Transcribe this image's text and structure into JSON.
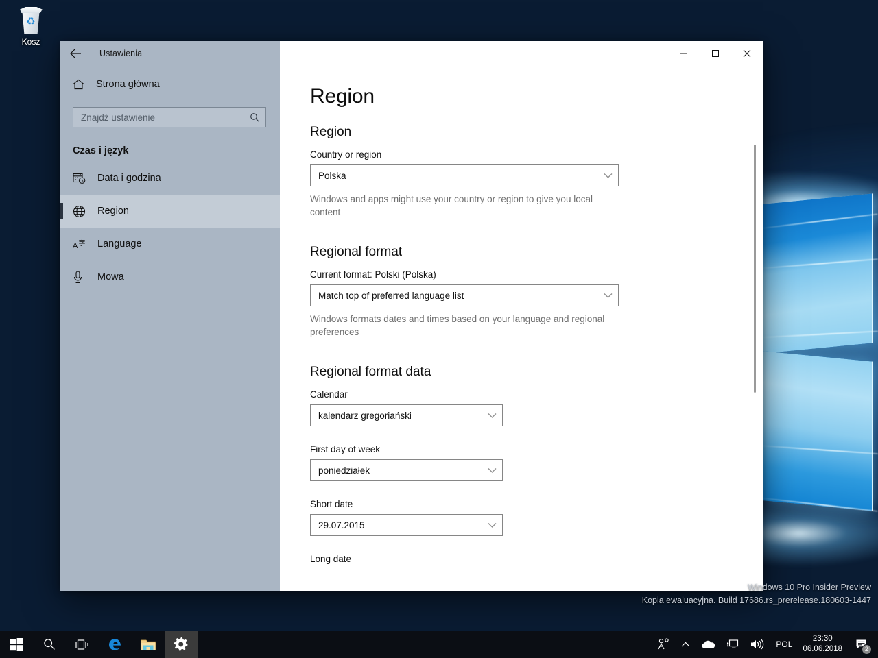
{
  "desktop": {
    "recycle_bin_label": "Kosz",
    "recycle_bin_icon": "recycle-bin-icon"
  },
  "window": {
    "title": "Ustawienia",
    "back_icon": "back-arrow-icon",
    "controls": {
      "minimize": "minimize-icon",
      "maximize": "maximize-icon",
      "close": "close-icon"
    }
  },
  "sidebar": {
    "home_label": "Strona główna",
    "home_icon": "home-icon",
    "search": {
      "placeholder": "Znajdź ustawienie",
      "value": "",
      "icon": "search-icon"
    },
    "section_title": "Czas i język",
    "items": [
      {
        "label": "Data i godzina",
        "icon": "calendar-clock-icon",
        "active": false
      },
      {
        "label": "Region",
        "icon": "globe-icon",
        "active": true
      },
      {
        "label": "Language",
        "icon": "language-icon",
        "active": false
      },
      {
        "label": "Mowa",
        "icon": "microphone-icon",
        "active": false
      }
    ]
  },
  "content": {
    "page_title": "Region",
    "sections": {
      "region": {
        "heading": "Region",
        "country_label": "Country or region",
        "country_value": "Polska",
        "country_helper": "Windows and apps might use your country or region to give you local content"
      },
      "regional_format": {
        "heading": "Regional format",
        "current_format_label": "Current format: Polski (Polska)",
        "format_value": "Match top of preferred language list",
        "format_helper": "Windows formats dates and times based on your language and regional preferences"
      },
      "regional_format_data": {
        "heading": "Regional format data",
        "fields": [
          {
            "label": "Calendar",
            "value": "kalendarz gregoriański"
          },
          {
            "label": "First day of week",
            "value": "poniedziałek"
          },
          {
            "label": "Short date",
            "value": "29.07.2015"
          }
        ],
        "clipped_label": "Long date"
      }
    },
    "chevron_icon": "chevron-down-icon",
    "scrollbar": "vertical-scrollbar"
  },
  "watermark": {
    "line1": "Windows 10 Pro Insider Preview",
    "line2": "Kopia ewaluacyjna. Build 17686.rs_prerelease.180603-1447"
  },
  "taskbar": {
    "buttons": [
      {
        "name": "start-button",
        "icon": "windows-logo-icon"
      },
      {
        "name": "search-button",
        "icon": "search-icon"
      },
      {
        "name": "task-view-button",
        "icon": "task-view-icon"
      },
      {
        "name": "edge-button",
        "icon": "edge-icon"
      },
      {
        "name": "file-explorer-button",
        "icon": "folder-icon"
      },
      {
        "name": "settings-button",
        "icon": "gear-icon"
      }
    ],
    "tray": {
      "people_icon": "people-icon",
      "overflow_icon": "chevron-up-icon",
      "onedrive_icon": "cloud-icon",
      "network_icon": "network-monitor-icon",
      "volume_icon": "speaker-icon",
      "language": "POL",
      "time": "23:30",
      "date": "06.06.2018",
      "action_center_icon": "action-center-icon",
      "notification_count": "2"
    }
  },
  "colors": {
    "sidebar_bg": "#aab6c4",
    "taskbar_bg": "#0b0e14",
    "accent": "#0078d7",
    "combo_border": "#868686",
    "helper_text": "#6f6f6f"
  }
}
